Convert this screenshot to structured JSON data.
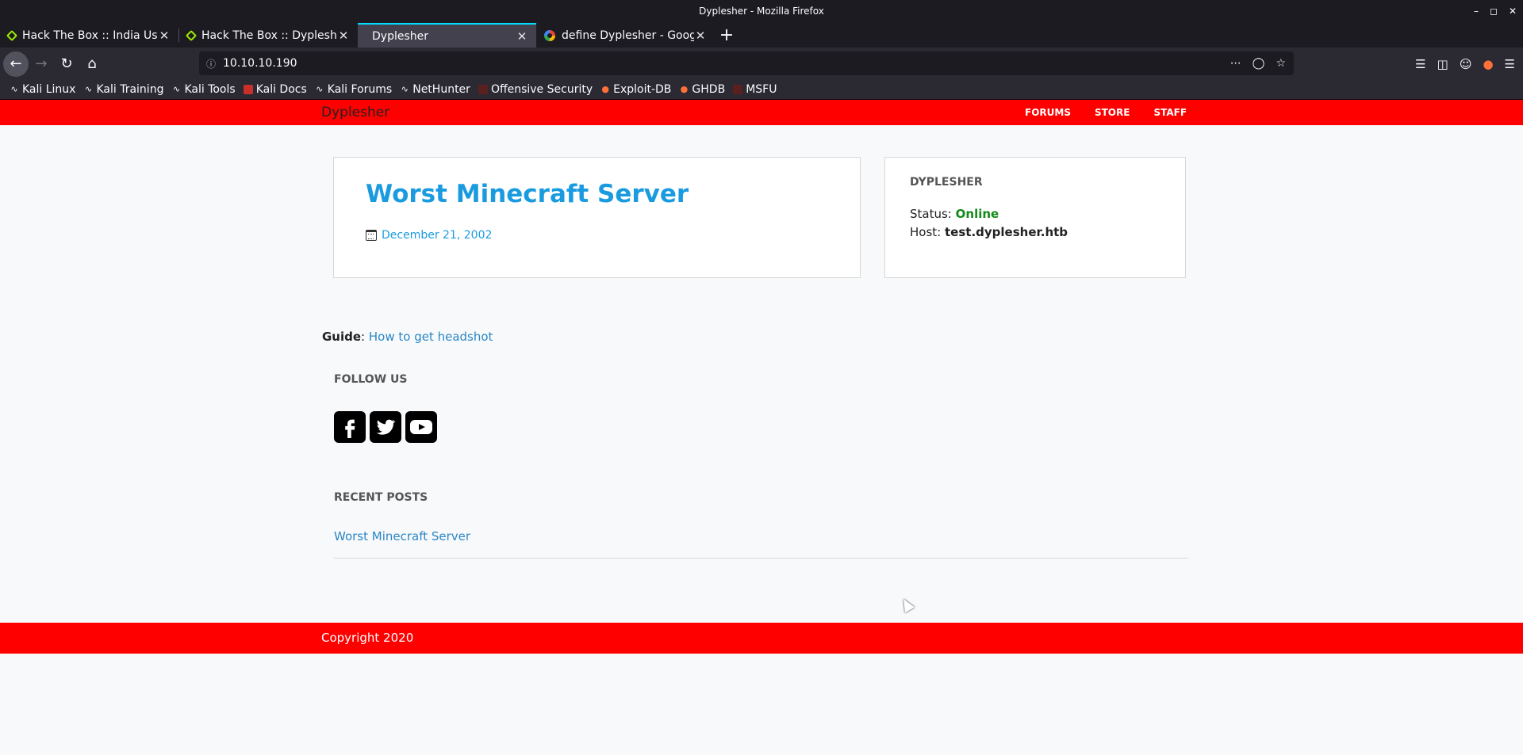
{
  "window": {
    "title": "Dyplesher - Mozilla Firefox"
  },
  "tabs": [
    {
      "label": "Hack The Box :: India Use",
      "icon": "htb-icon"
    },
    {
      "label": "Hack The Box :: Dyplesher",
      "icon": "htb-icon"
    },
    {
      "label": "Dyplesher",
      "icon": "",
      "active": true
    },
    {
      "label": "define Dyplesher - Googl",
      "icon": "google-icon"
    }
  ],
  "address_bar": {
    "url": "10.10.10.190"
  },
  "bookmarks": [
    {
      "label": "Kali Linux",
      "icon": "kali-dragon-icon"
    },
    {
      "label": "Kali Training",
      "icon": "kali-dragon-icon"
    },
    {
      "label": "Kali Tools",
      "icon": "kali-dragon-icon"
    },
    {
      "label": "Kali Docs",
      "icon": "kali-docs-icon"
    },
    {
      "label": "Kali Forums",
      "icon": "kali-dragon-icon"
    },
    {
      "label": "NetHunter",
      "icon": "nethunter-icon"
    },
    {
      "label": "Offensive Security",
      "icon": "offsec-icon"
    },
    {
      "label": "Exploit-DB",
      "icon": "exploitdb-icon"
    },
    {
      "label": "GHDB",
      "icon": "ghdb-icon"
    },
    {
      "label": "MSFU",
      "icon": "msfu-icon"
    }
  ],
  "site": {
    "brand": "Dyplesher",
    "nav": [
      "FORUMS",
      "STORE",
      "STAFF"
    ],
    "accent_color": "#ff0000",
    "link_color": "#1a9be0"
  },
  "post": {
    "title": "Worst Minecraft Server",
    "date": "December 21, 2002"
  },
  "status_card": {
    "heading": "DYPLESHER",
    "status_label": "Status:",
    "status_value": "Online",
    "host_label": "Host:",
    "host_value": "test.dyplesher.htb"
  },
  "guide": {
    "label": "Guide",
    "link": "How to get headshot"
  },
  "follow": {
    "heading": "FOLLOW US",
    "icons": [
      "facebook-icon",
      "twitter-icon",
      "youtube-icon"
    ]
  },
  "recent_posts": {
    "heading": "RECENT POSTS",
    "items": [
      "Worst Minecraft Server"
    ]
  },
  "footer": {
    "copyright": "Copyright 2020"
  }
}
